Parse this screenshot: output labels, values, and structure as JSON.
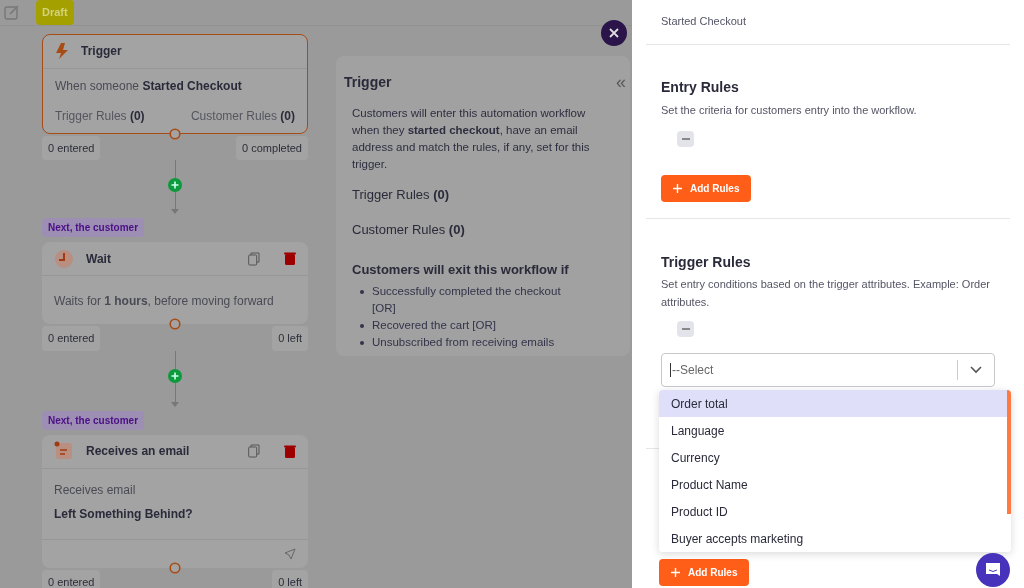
{
  "toolbar": {
    "status_badge": "Draft"
  },
  "trigger_card": {
    "title": "Trigger",
    "event_prefix": "When someone",
    "event": "Started Checkout",
    "trigger_rules_label": "Trigger Rules",
    "trigger_rules_count": "(0)",
    "customer_rules_label": "Customer Rules",
    "customer_rules_count": "(0)",
    "entered": "0 entered",
    "completed": "0 completed"
  },
  "steps": [
    {
      "kind": "wait",
      "label": "Next, the customer",
      "title": "Wait",
      "body": "Waits for **1 hours**, before moving forward",
      "entered": "0 entered",
      "left": "0 left"
    },
    {
      "kind": "email",
      "label": "Next, the customer",
      "title": "Receives an email",
      "subtitle": "Receives email",
      "body": "Left Something Behind?",
      "entered": "0 entered",
      "left": "0 left"
    }
  ],
  "info_panel": {
    "title": "Trigger",
    "collapse_glyph": "«",
    "description": "Customers will enter this automation workflow when they **started checkout**, have an email address and match the rules, if any, set for this trigger.",
    "trigger_rules": "Trigger Rules",
    "trigger_rules_count": "(0)",
    "customer_rules": "Customer Rules",
    "customer_rules_count": "(0)",
    "exit_heading": "Customers will exit this workflow if",
    "exit_conditions": [
      "Successfully completed the checkout [OR]",
      "Recovered the cart [OR]",
      "Unsubscribed from receiving emails"
    ]
  },
  "drawer": {
    "entry_type": "Started Checkout",
    "entry_rules": {
      "title": "Entry Rules",
      "description": "Set the criteria for customers entry into the workflow.",
      "add_button": "Add Rules"
    },
    "trigger_rules": {
      "title": "Trigger Rules",
      "description": "Set entry conditions based on the trigger attributes. Example: Order attributes.",
      "select_placeholder": "--Select",
      "options": [
        {
          "label": "Order total",
          "selected": true
        },
        {
          "label": "Language",
          "selected": false
        },
        {
          "label": "Currency",
          "selected": false
        },
        {
          "label": "Product Name",
          "selected": false
        },
        {
          "label": "Product ID",
          "selected": false
        },
        {
          "label": "Buyer accepts marketing",
          "selected": false
        }
      ],
      "add_button": "Add Rules"
    }
  }
}
